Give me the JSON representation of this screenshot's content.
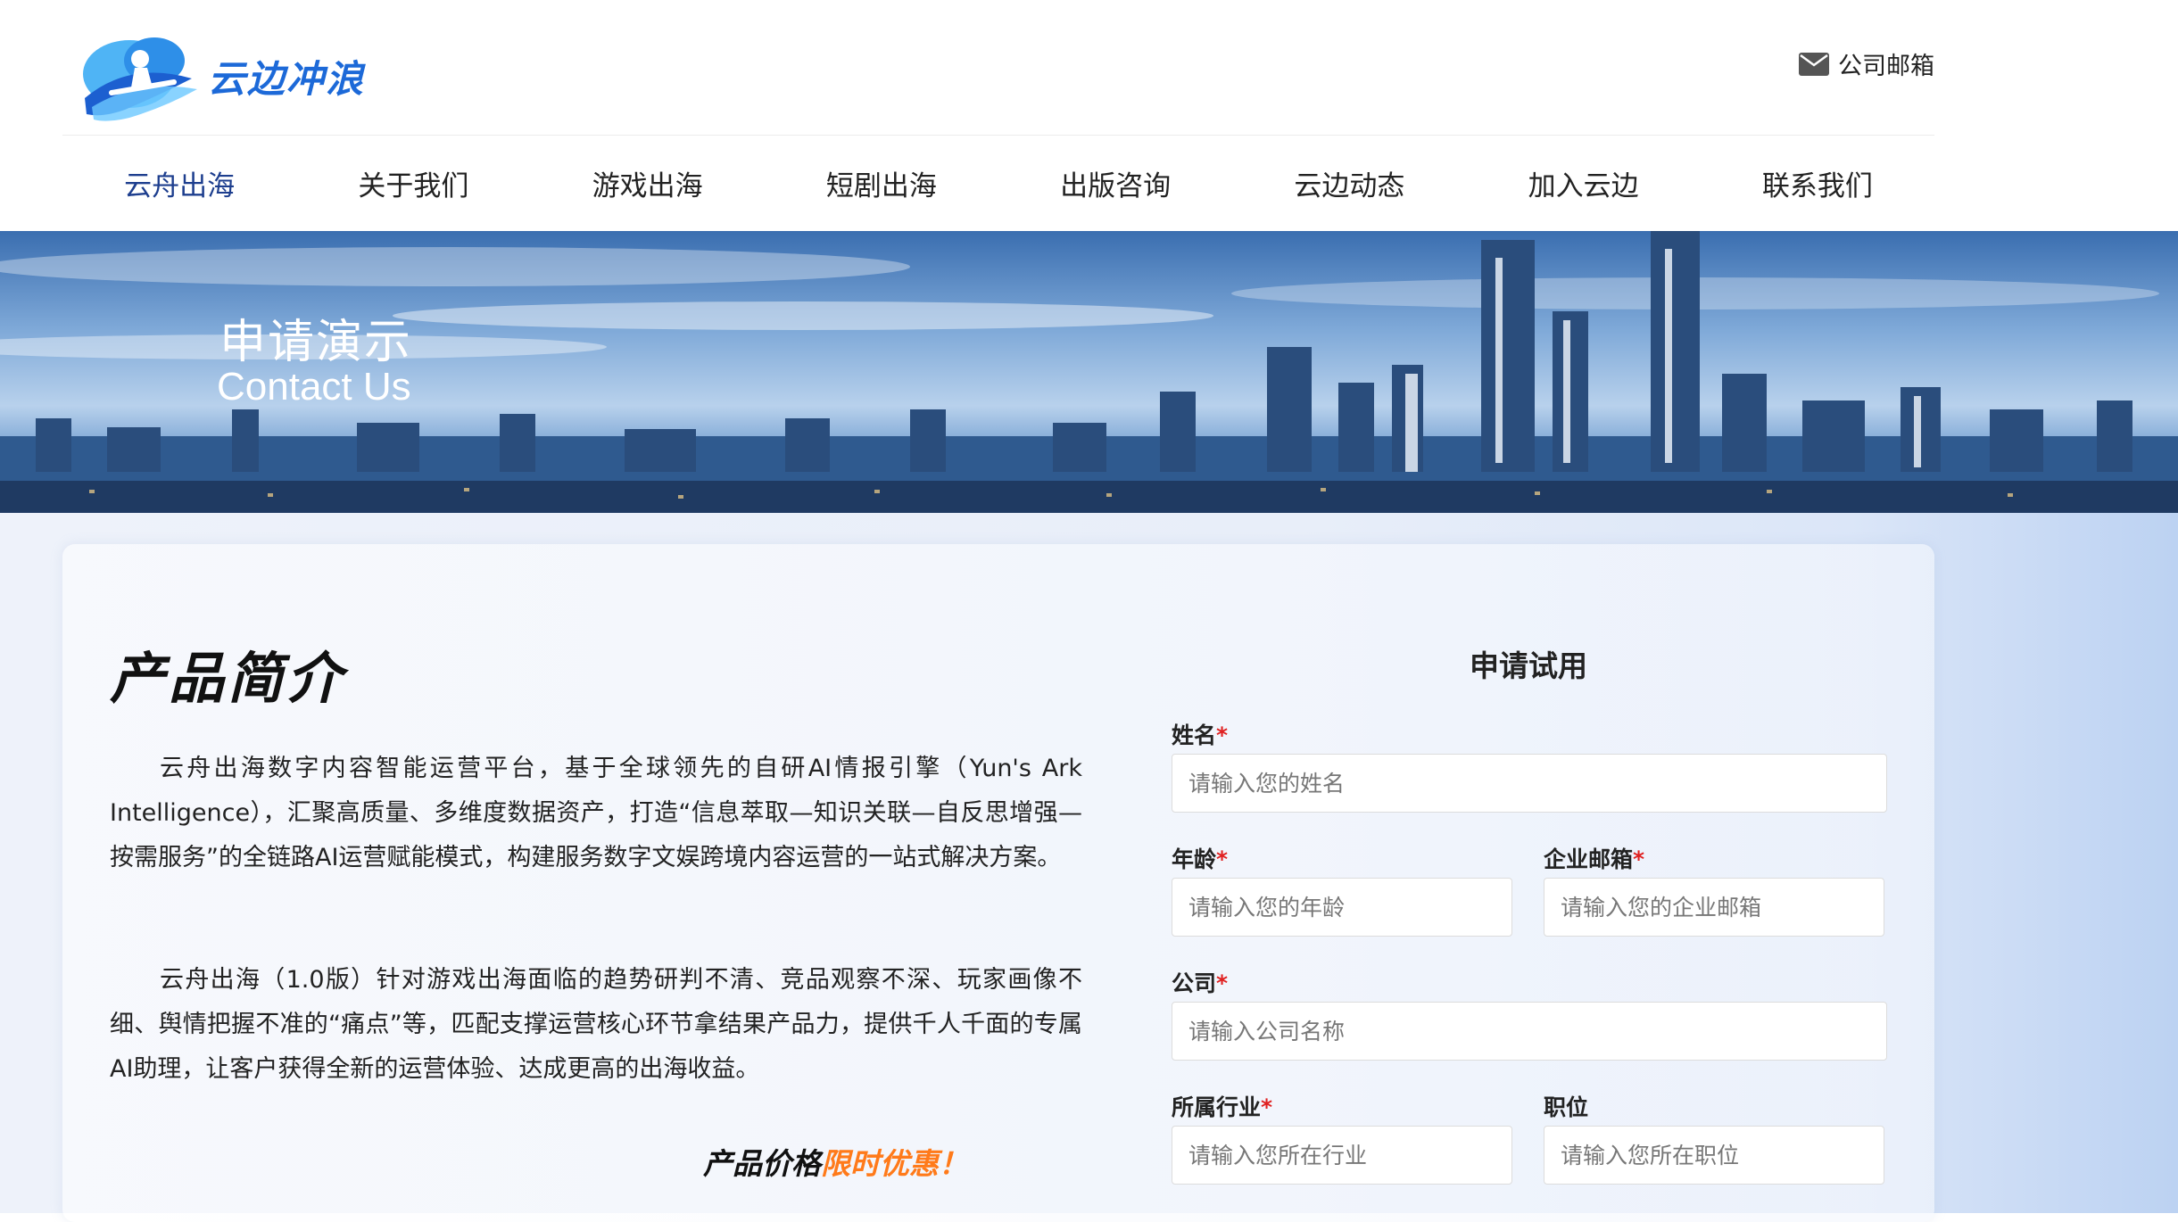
{
  "brand": {
    "name": "云边冲浪",
    "color": "#1c69d8"
  },
  "header": {
    "mail_label": "公司邮箱",
    "mail_icon": "envelope-icon"
  },
  "nav": {
    "items": [
      {
        "label": "云舟出海",
        "active": true
      },
      {
        "label": "关于我们"
      },
      {
        "label": "游戏出海"
      },
      {
        "label": "短剧出海"
      },
      {
        "label": "出版咨询"
      },
      {
        "label": "云边动态"
      },
      {
        "label": "加入云边"
      },
      {
        "label": "联系我们"
      }
    ],
    "active_color": "#1d3e8e"
  },
  "banner": {
    "title": "申请演示",
    "subtitle": "Contact Us"
  },
  "intro": {
    "title": "产品简介",
    "para1": "云舟出海数字内容智能运营平台，基于全球领先的自研AI情报引擎（Yun's Ark Intelligence），汇聚高质量、多维度数据资产，打造“信息萃取—知识关联—自反思增强—按需服务”的全链路AI运营赋能模式，构建服务数字文娱跨境内容运营的一站式解决方案。",
    "para2": "云舟出海（1.0版）针对游戏出海面临的趋势研判不清、竞品观察不深、玩家画像不细、舆情把握不准的“痛点”等，匹配支撑运营核心环节拿结果产品力，提供千人千面的专属AI助理，让客户获得全新的运营体验、达成更高的出海收益。",
    "price_prefix": "产品价格",
    "price_highlight": "限时优惠！",
    "highlight_color": "#ff7a1a"
  },
  "form": {
    "title": "申请试用",
    "name": {
      "label": "姓名",
      "required": "*",
      "placeholder": "请输入您的姓名"
    },
    "age": {
      "label": "年龄",
      "required": "*",
      "placeholder": "请输入您的年龄"
    },
    "email": {
      "label": "企业邮箱",
      "required": "*",
      "placeholder": "请输入您的企业邮箱"
    },
    "company": {
      "label": "公司",
      "required": "*",
      "placeholder": "请输入公司名称"
    },
    "industry": {
      "label": "所属行业",
      "required": "*",
      "placeholder": "请输入您所在行业"
    },
    "position": {
      "label": "职位",
      "placeholder": "请输入您所在职位"
    }
  }
}
